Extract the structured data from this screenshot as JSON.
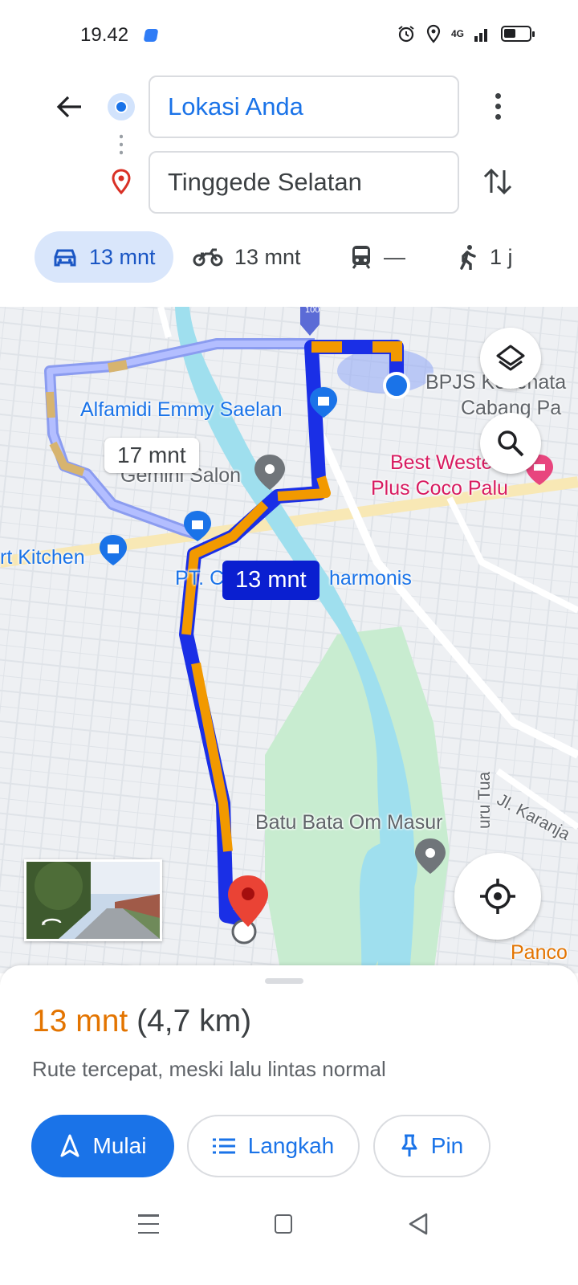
{
  "status": {
    "time": "19.42",
    "network": "4G"
  },
  "search": {
    "origin": "Lokasi Anda",
    "destination": "Tinggede Selatan"
  },
  "modes": [
    {
      "name": "car",
      "label": "13 mnt",
      "active": true
    },
    {
      "name": "motorcycle",
      "label": "13 mnt",
      "active": false
    },
    {
      "name": "transit",
      "label": "—",
      "active": false
    },
    {
      "name": "walk",
      "label": "1 j",
      "active": false
    }
  ],
  "map": {
    "labels": {
      "alfamidi": "Alfamidi Emmy Saelan",
      "gemini": "Gemini Salon",
      "kitchen": "rt Kitchen",
      "ptc_left": "PT. C",
      "ptc_right": "harmonis",
      "bpjs1": "BPJS Kesehata",
      "bpjs2": "Cabang Pa",
      "best1": "Best Weste",
      "best2": "Plus Coco Palu",
      "batu": "Batu Bata Om Masur",
      "karanja": "Jl. Karanja",
      "guru": "uru Tua",
      "panco": "Panco",
      "road_shield": "100"
    },
    "alt_route_label": "17 mnt",
    "main_route_label": "13 mnt",
    "colors": {
      "route": "#1a2fe6",
      "traffic": "#f29900",
      "alt_route": "#8b9cf0",
      "water": "#9fdfee",
      "park": "#c8ecd0"
    }
  },
  "summary": {
    "eta": "13 mnt",
    "distance": "(4,7 km)",
    "description": "Rute tercepat, meski lalu lintas normal"
  },
  "actions": {
    "start": "Mulai",
    "steps": "Langkah",
    "pin": "Pin"
  }
}
